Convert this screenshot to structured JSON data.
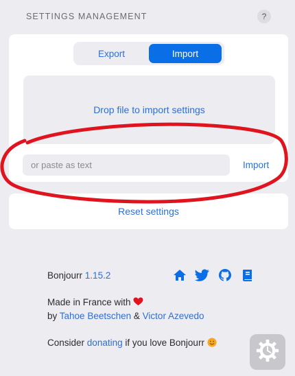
{
  "header": {
    "title": "SETTINGS MANAGEMENT",
    "help_label": "?"
  },
  "tabs": {
    "export_label": "Export",
    "import_label": "Import",
    "selected": "Import"
  },
  "import": {
    "dropzone_label": "Drop file to import settings",
    "paste_placeholder": "or paste as text",
    "import_link_label": "Import"
  },
  "reset": {
    "label": "Reset settings"
  },
  "footer": {
    "app_name": "Bonjourr",
    "version": "1.15.2",
    "made_in": "Made in France with",
    "by": "by",
    "author1": "Tahoe Beetschen",
    "amp": "&",
    "author2": "Victor Azevedo",
    "consider": "Consider",
    "donating": "donating",
    "if_you_love": "if you love Bonjourr",
    "icons": [
      "home-icon",
      "twitter-icon",
      "github-icon",
      "book-icon"
    ]
  },
  "colors": {
    "accent": "#0a6ee6",
    "link": "#2d6fd6",
    "annotation": "#e0141e",
    "background": "#ececf1"
  }
}
